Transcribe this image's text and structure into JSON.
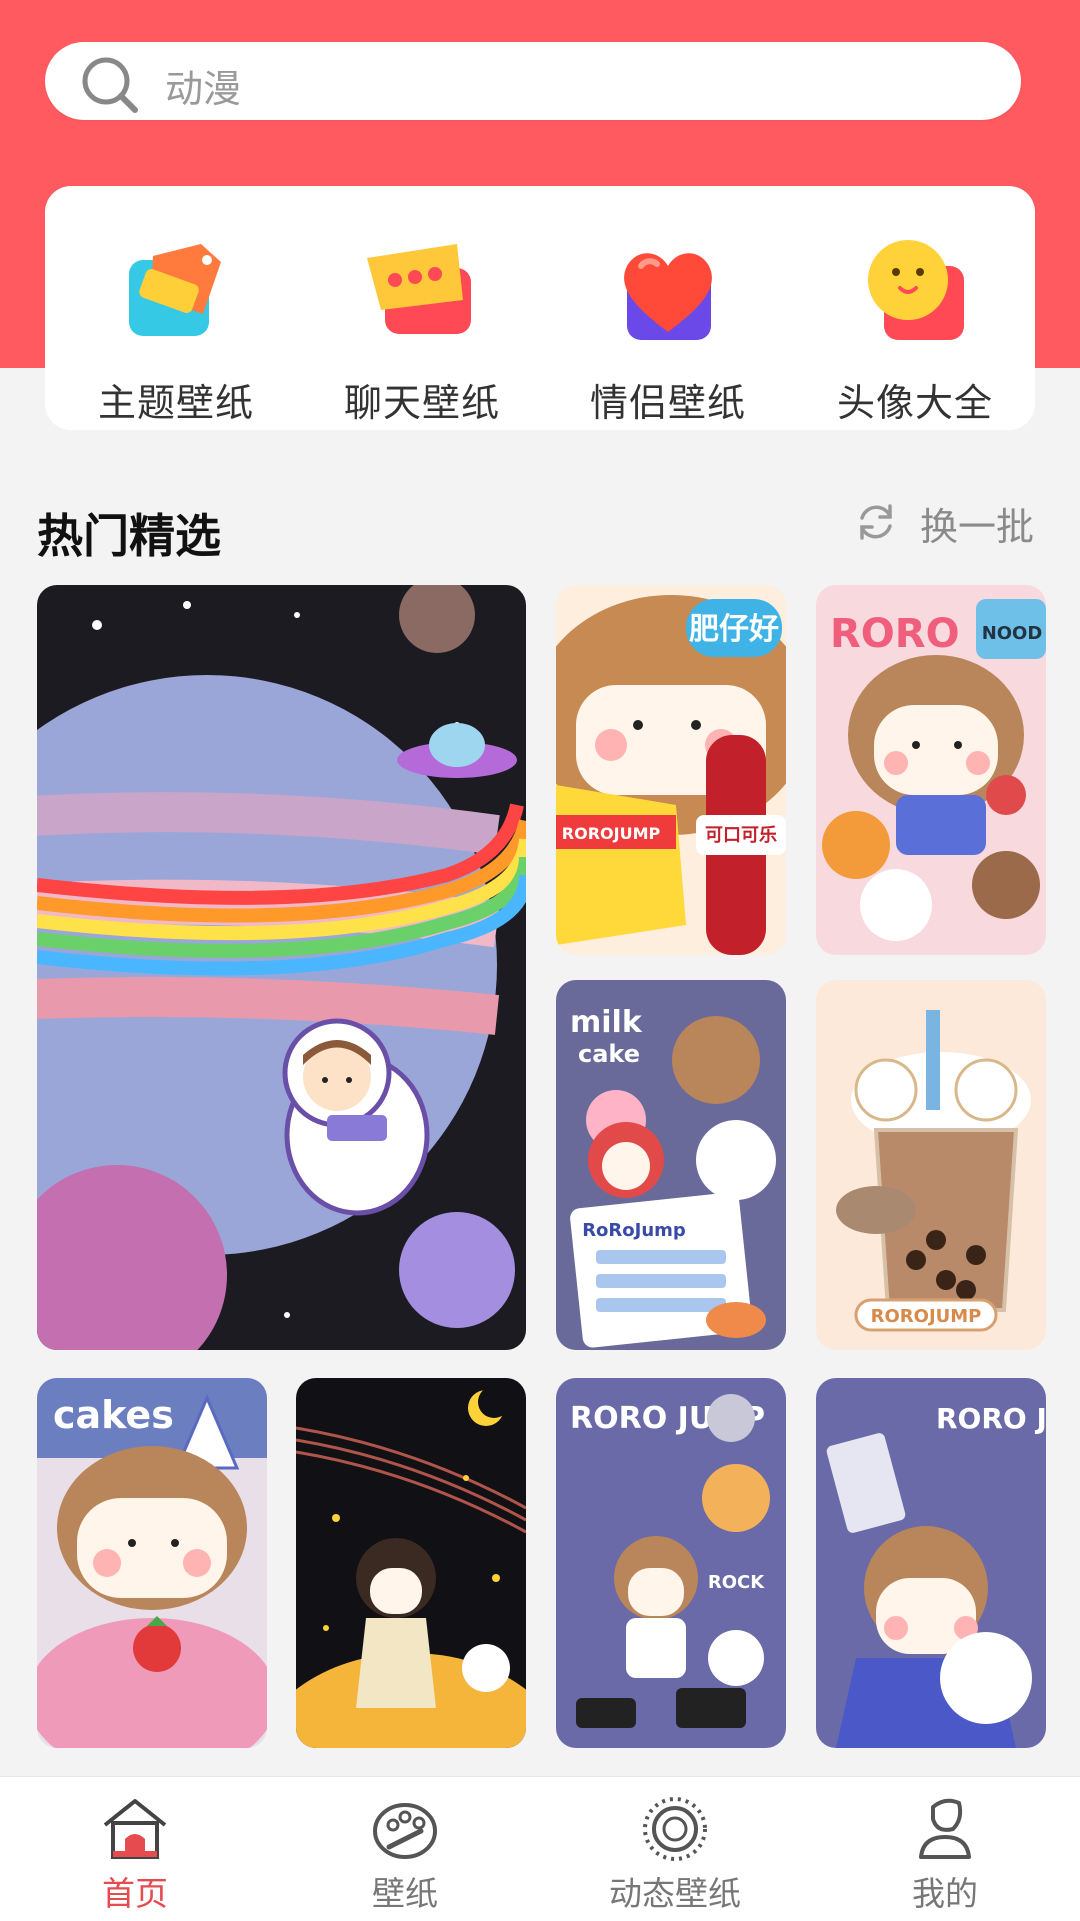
{
  "search": {
    "placeholder": "动漫",
    "icon": "search-icon"
  },
  "categories": [
    {
      "label": "主题壁纸",
      "icon": "tag-icon"
    },
    {
      "label": "聊天壁纸",
      "icon": "chat-bubble-icon"
    },
    {
      "label": "情侣壁纸",
      "icon": "heart-icon"
    },
    {
      "label": "头像大全",
      "icon": "smiley-face-icon"
    }
  ],
  "section": {
    "title": "热门精选",
    "refresh_label": "换一批",
    "refresh_icon": "refresh-icon"
  },
  "wallpapers": {
    "w1": {
      "badge": ""
    },
    "w2": {
      "title": "肥仔好",
      "chip": "ROROJUMP",
      "cola": "可口可乐"
    },
    "w3": {
      "title": "RORO",
      "tag": "NOOD"
    },
    "w4": {
      "title1": "milk",
      "title2": "cake",
      "menu_title": "RoRoJump"
    },
    "w5": {
      "title": "ROROJUMP"
    },
    "w6": {
      "title": "cakes"
    },
    "w7": {},
    "w8": {
      "title": "RORO JUMP",
      "tag": "ROCK"
    },
    "w9": {
      "title": "RORO JUMP"
    }
  },
  "tabs": [
    {
      "label": "首页",
      "icon": "home-icon",
      "active": true
    },
    {
      "label": "壁纸",
      "icon": "palette-icon",
      "active": false
    },
    {
      "label": "动态壁纸",
      "icon": "animated-ring-icon",
      "active": false
    },
    {
      "label": "我的",
      "icon": "profile-icon",
      "active": false
    }
  ],
  "colors": {
    "header": "#ff5a5f",
    "accent": "#e64b4f",
    "background": "#f3f3f4"
  }
}
